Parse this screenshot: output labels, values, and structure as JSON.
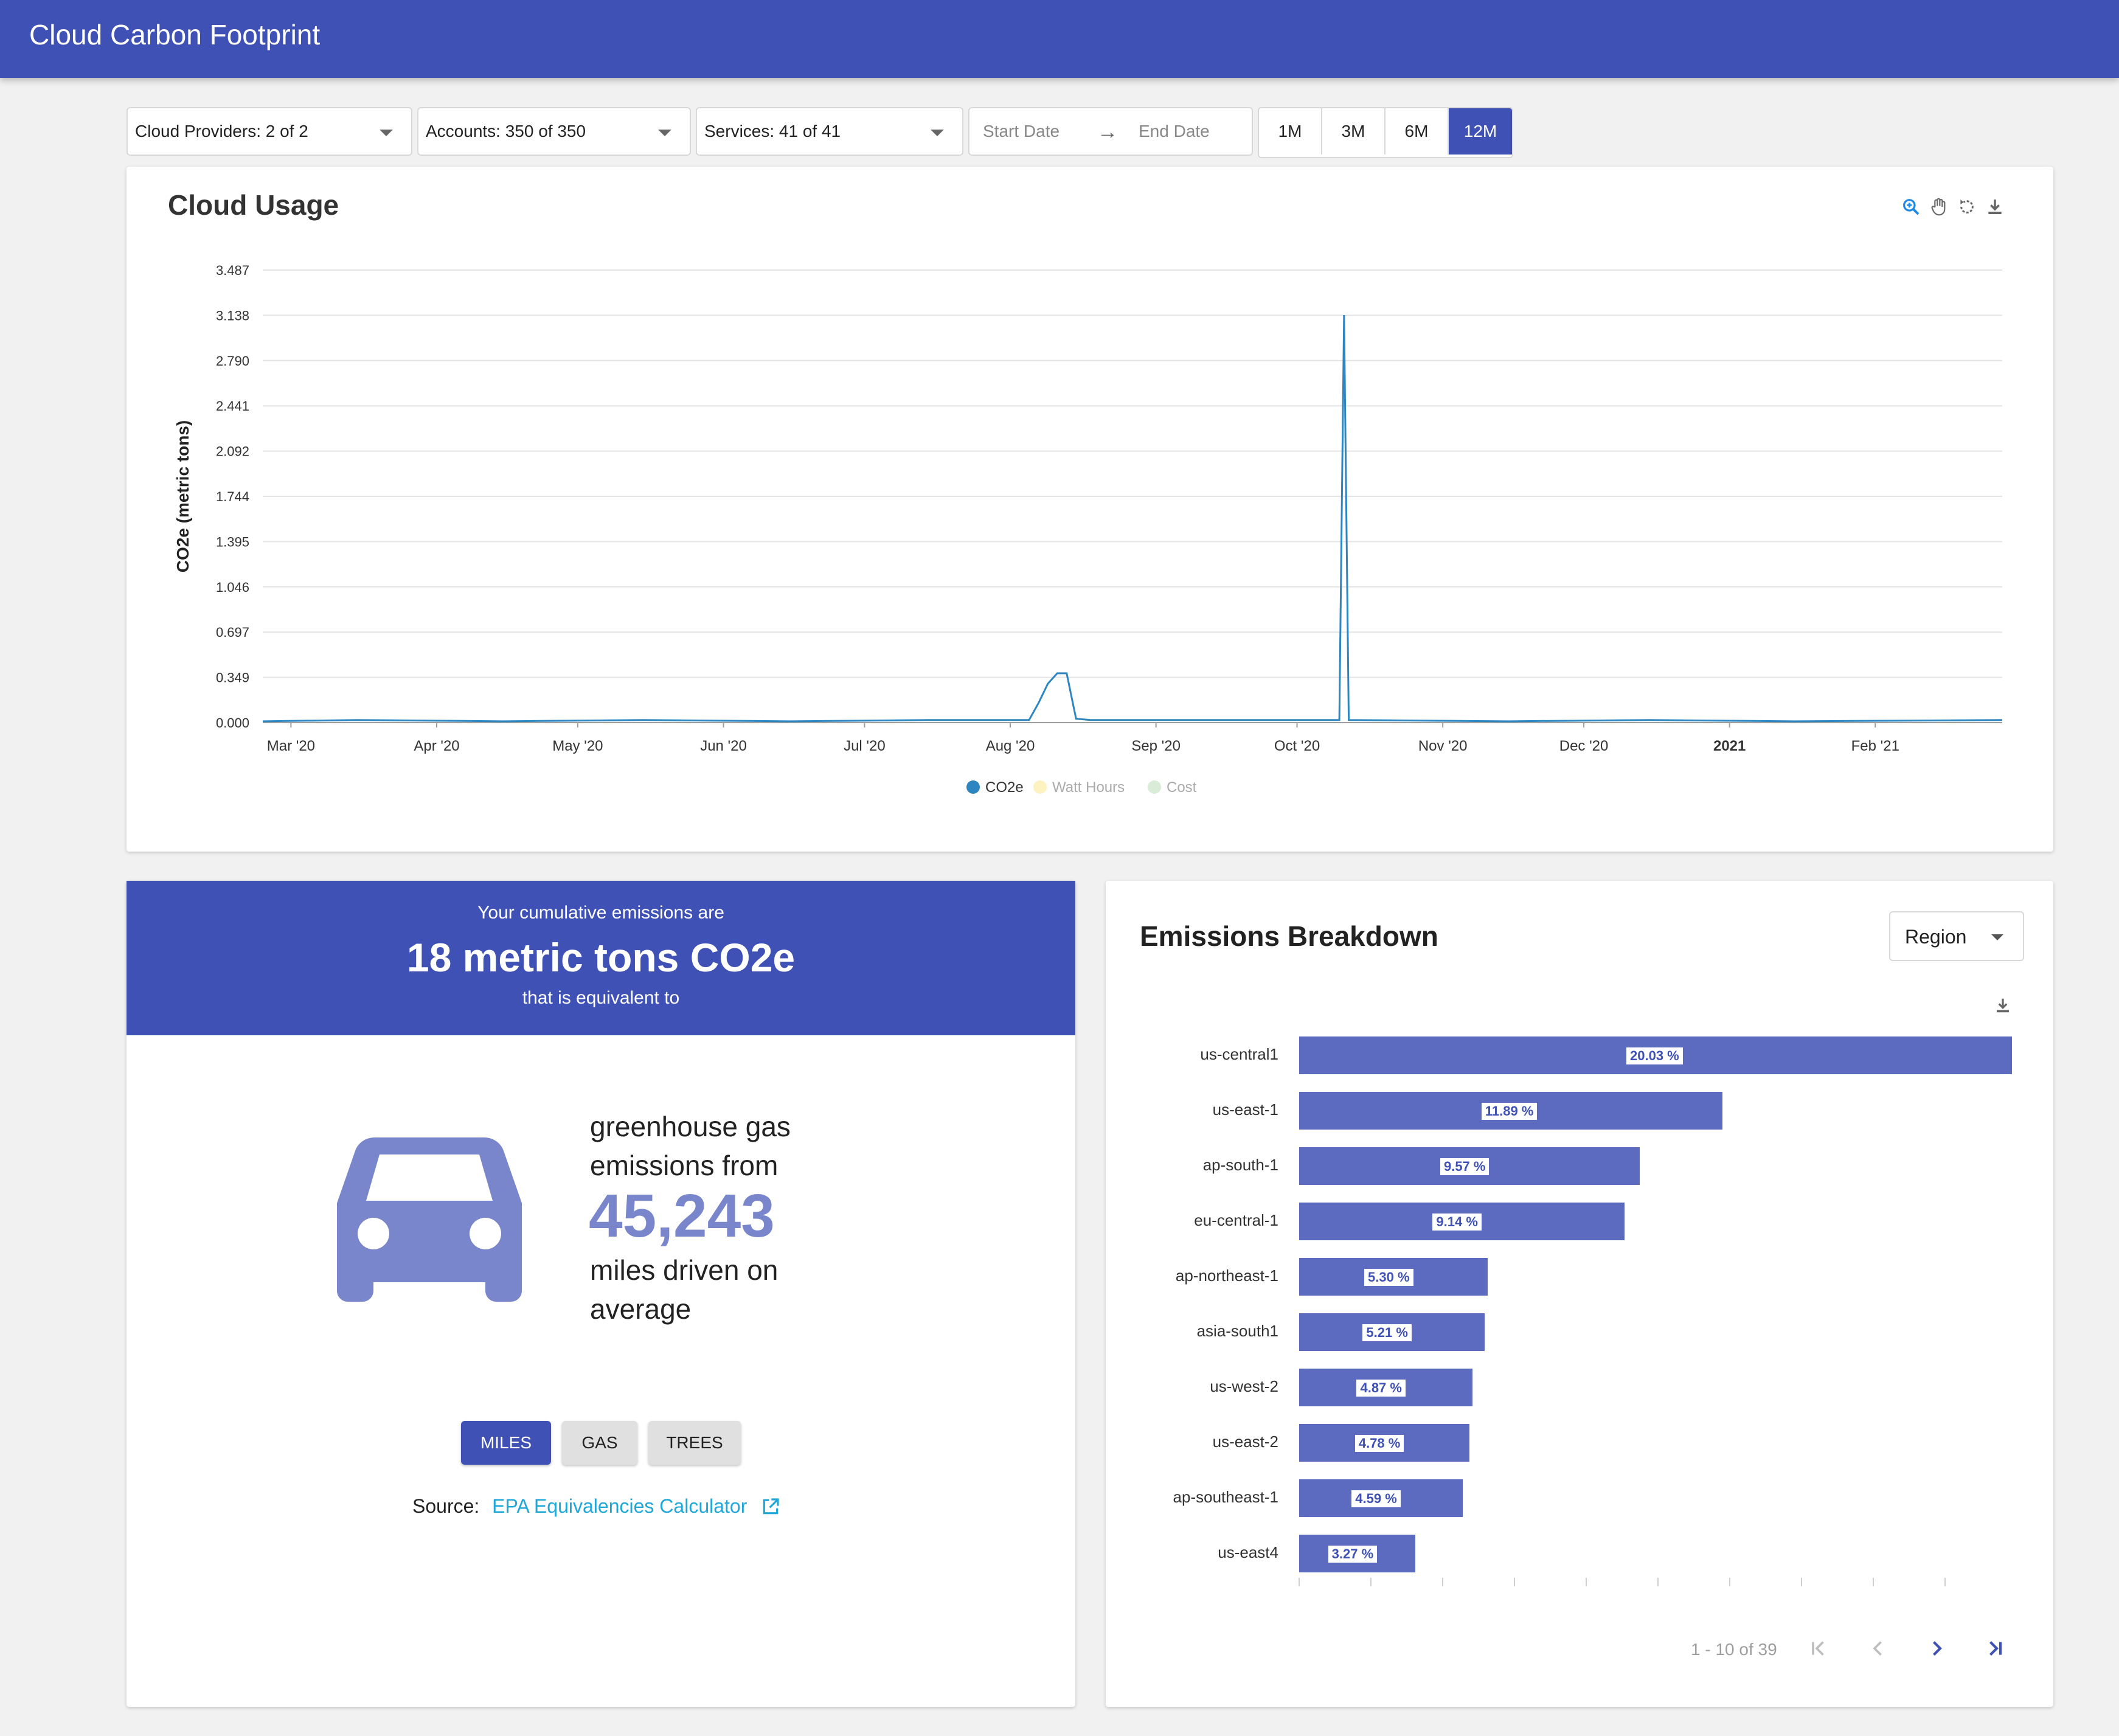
{
  "app": {
    "title": "Cloud Carbon Footprint"
  },
  "filters": {
    "providers": "Cloud Providers: 2 of 2",
    "accounts": "Accounts: 350 of 350",
    "services": "Services: 41 of 41",
    "start_placeholder": "Start Date",
    "end_placeholder": "End Date",
    "arrow": "→",
    "ranges": [
      "1M",
      "3M",
      "6M",
      "12M"
    ],
    "active_range": "12M"
  },
  "usage": {
    "title": "Cloud Usage",
    "icons": [
      "zoom-in-icon",
      "pan-hand-icon",
      "reset-icon",
      "download-icon"
    ]
  },
  "chart_data": {
    "type": "line",
    "title": "",
    "ylabel": "CO2e (metric tons)",
    "xlabel": "",
    "ylim": [
      0,
      3.487
    ],
    "y_ticks": [
      "0.000",
      "0.349",
      "0.697",
      "1.046",
      "1.395",
      "1.744",
      "2.092",
      "2.441",
      "2.790",
      "3.138",
      "3.487"
    ],
    "x_ticks": [
      "Mar '20",
      "Apr '20",
      "May '20",
      "Jun '20",
      "Jul '20",
      "Aug '20",
      "Sep '20",
      "Oct '20",
      "Nov '20",
      "Dec '20",
      "2021",
      "Feb '21"
    ],
    "x_tick_bold": "2021",
    "legend": [
      {
        "name": "CO2e",
        "color": "#2e86c1",
        "active": true
      },
      {
        "name": "Watt Hours",
        "color": "#fdf2c0",
        "active": false
      },
      {
        "name": "Cost",
        "color": "#d8ecd8",
        "active": false
      }
    ],
    "series": [
      {
        "name": "CO2e",
        "color": "#2e86c1",
        "x": [
          "2020-02-24",
          "2020-03-15",
          "2020-04-15",
          "2020-05-15",
          "2020-06-15",
          "2020-07-15",
          "2020-08-05",
          "2020-08-07",
          "2020-08-09",
          "2020-08-11",
          "2020-08-13",
          "2020-08-15",
          "2020-08-18",
          "2020-09-15",
          "2020-10-10",
          "2020-10-11",
          "2020-10-12",
          "2020-11-15",
          "2020-12-15",
          "2021-01-15",
          "2021-02-28"
        ],
        "values": [
          0.01,
          0.02,
          0.01,
          0.02,
          0.01,
          0.02,
          0.02,
          0.15,
          0.3,
          0.38,
          0.38,
          0.03,
          0.02,
          0.02,
          0.02,
          3.14,
          0.02,
          0.01,
          0.02,
          0.01,
          0.02
        ]
      }
    ]
  },
  "equivalency": {
    "line1": "Your cumulative emissions are",
    "line2": "18 metric tons CO2e",
    "line3": "that is equivalent to",
    "text_before_1": "greenhouse gas",
    "text_before_2": "emissions from",
    "number": "45,243",
    "text_after_1": "miles driven on",
    "text_after_2": "average",
    "icon": "car-icon",
    "buttons": [
      "MILES",
      "GAS",
      "TREES"
    ],
    "active_button": "MILES",
    "source_label": "Source:",
    "source_link": "EPA Equivalencies Calculator",
    "source_icon": "external-link-icon"
  },
  "breakdown": {
    "title": "Emissions Breakdown",
    "select": "Region",
    "download_icon": "download-icon",
    "rows": [
      {
        "label": "us-central1",
        "pct": 20.03,
        "text": "20.03 %"
      },
      {
        "label": "us-east-1",
        "pct": 11.89,
        "text": "11.89 %"
      },
      {
        "label": "ap-south-1",
        "pct": 9.57,
        "text": "9.57 %"
      },
      {
        "label": "eu-central-1",
        "pct": 9.14,
        "text": "9.14 %"
      },
      {
        "label": "ap-northeast-1",
        "pct": 5.3,
        "text": "5.30 %"
      },
      {
        "label": "asia-south1",
        "pct": 5.21,
        "text": "5.21 %"
      },
      {
        "label": "us-west-2",
        "pct": 4.87,
        "text": "4.87 %"
      },
      {
        "label": "us-east-2",
        "pct": 4.78,
        "text": "4.78 %"
      },
      {
        "label": "ap-southeast-1",
        "pct": 4.59,
        "text": "4.59 %"
      },
      {
        "label": "us-east4",
        "pct": 3.27,
        "text": "3.27 %"
      }
    ],
    "pager": "1 - 10 of 39",
    "pager_icons": {
      "first": "⏮",
      "prev": "‹",
      "next": "›",
      "last": "⏭"
    }
  }
}
